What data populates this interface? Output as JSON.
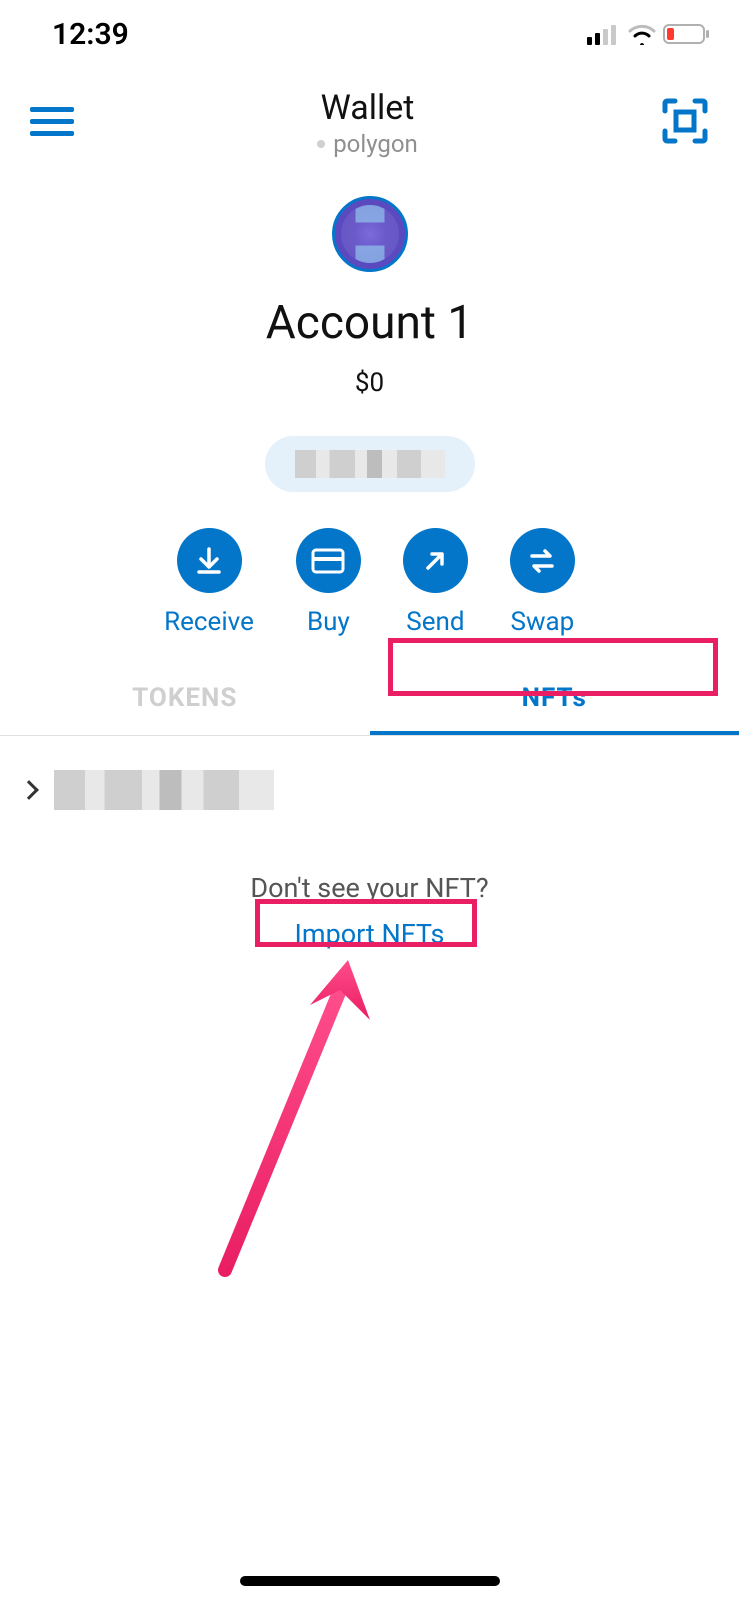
{
  "status_bar": {
    "time": "12:39"
  },
  "nav": {
    "title": "Wallet",
    "network": "polygon"
  },
  "account": {
    "name": "Account 1",
    "balance": "$0"
  },
  "actions": {
    "receive": "Receive",
    "buy": "Buy",
    "send": "Send",
    "swap": "Swap"
  },
  "tabs": {
    "tokens": "TOKENS",
    "nfts": "NFTs"
  },
  "import": {
    "prompt": "Don't see your NFT?",
    "link": "Import NFTs"
  },
  "colors": {
    "primary": "#0376c9",
    "highlight": "#e91e63"
  }
}
